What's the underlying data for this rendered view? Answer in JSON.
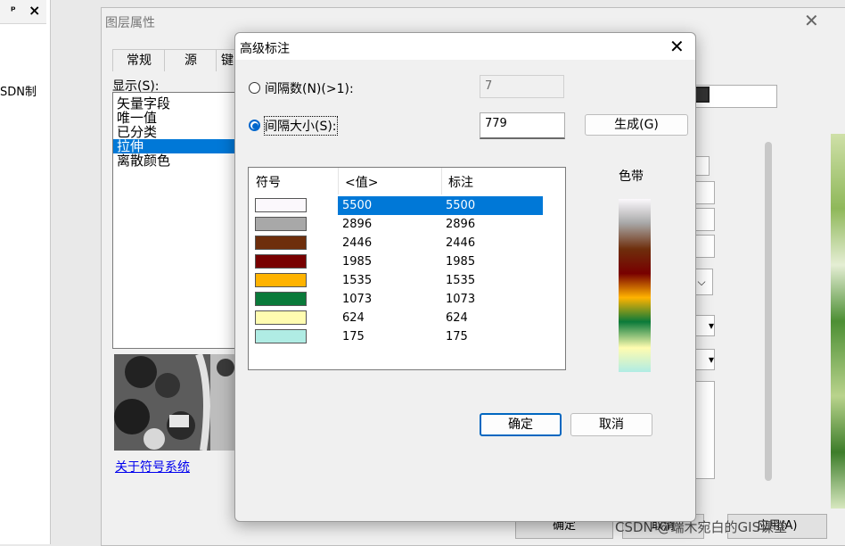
{
  "dock": {
    "title_icons": [
      "pin-icon",
      "close-icon"
    ],
    "partial_text": "SDN制"
  },
  "layer_window": {
    "title": "图层属性",
    "tabs": [
      {
        "label": "常规"
      },
      {
        "label": "源"
      },
      {
        "label": "键"
      }
    ],
    "show_label": "显示(S):",
    "list_items": [
      {
        "label": "矢量字段"
      },
      {
        "label": "唯一值"
      },
      {
        "label": "已分类"
      },
      {
        "label": "拉伸",
        "selected": true
      },
      {
        "label": "离散颜色"
      }
    ],
    "link_text": "关于符号系统",
    "bottom_buttons": [
      {
        "label": "确定"
      },
      {
        "label": "取消"
      },
      {
        "label": "应用(A)"
      }
    ],
    "watermark": "CSDN @端木宛白的GIS课堂"
  },
  "dialog": {
    "title": "高级标注",
    "radio_interval_count": {
      "label": "间隔数(N)(>1):",
      "selected": false,
      "value": "7"
    },
    "radio_interval_size": {
      "label": "间隔大小(S):",
      "selected": true,
      "value": "779"
    },
    "generate_button": "生成(G)",
    "table": {
      "headers": {
        "symbol": "符号",
        "value": "<值>",
        "label": "标注"
      },
      "rows": [
        {
          "color": "#fbf8fc",
          "value": "5500",
          "label": "5500",
          "selected": true
        },
        {
          "color": "#a8a8a8",
          "value": "2896",
          "label": "2896"
        },
        {
          "color": "#6e2e0c",
          "value": "2446",
          "label": "2446"
        },
        {
          "color": "#780000",
          "value": "1985",
          "label": "1985"
        },
        {
          "color": "#ffb300",
          "value": "1535",
          "label": "1535"
        },
        {
          "color": "#0a7a3a",
          "value": "1073",
          "label": "1073"
        },
        {
          "color": "#fffcb0",
          "value": "624",
          "label": "624"
        },
        {
          "color": "#b0ece4",
          "value": "175",
          "label": "175"
        }
      ]
    },
    "color_ramp_label": "色带",
    "color_ramp_colors": [
      "#fbf8fc",
      "#a8a8a8",
      "#6e2e0c",
      "#780000",
      "#ffb300",
      "#0a7a3a",
      "#fffcb0",
      "#b0ece4"
    ],
    "ok_button": "确定",
    "cancel_button": "取消"
  }
}
